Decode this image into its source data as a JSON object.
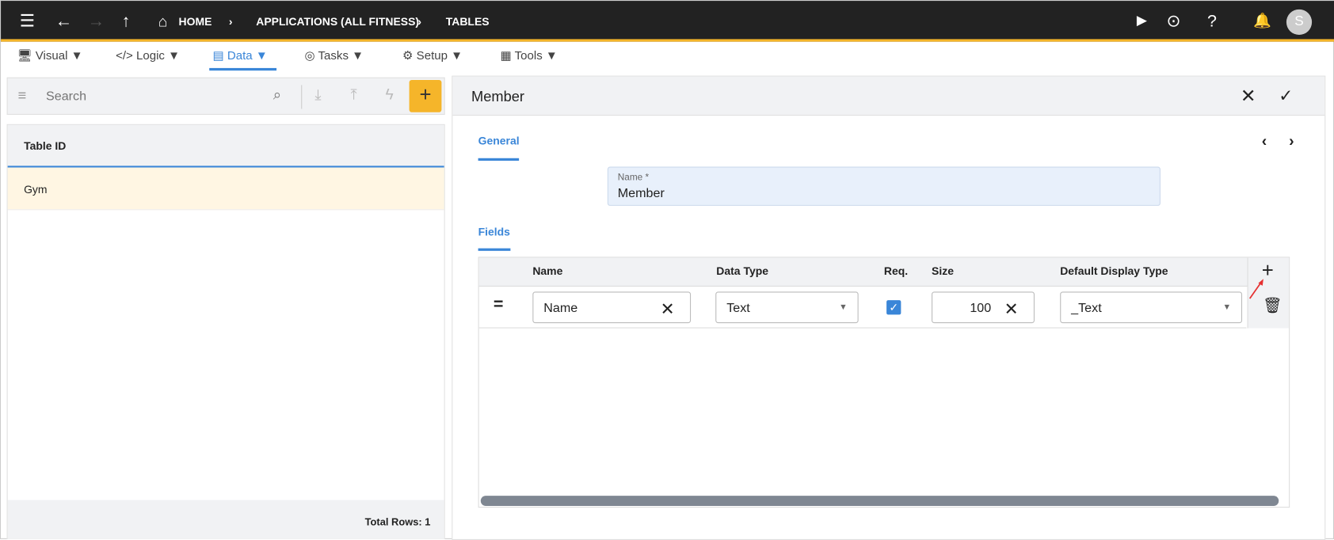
{
  "topbar": {
    "breadcrumb": [
      "HOME",
      "APPLICATIONS (ALL FITNESS)",
      "TABLES"
    ],
    "avatar": "S",
    "accent": "#f5b52a"
  },
  "menu": [
    {
      "label": "Visual ▼"
    },
    {
      "label": "Logic ▼"
    },
    {
      "label": "Data ▼",
      "active": true
    },
    {
      "label": "Tasks ▼"
    },
    {
      "label": "Setup ▼"
    },
    {
      "label": "Tools ▼"
    }
  ],
  "left": {
    "search_placeholder": "Search",
    "column": "Table ID",
    "rows": [
      "Gym"
    ],
    "footer": "Total Rows: 1"
  },
  "right": {
    "title": "Member",
    "tab_general": "General",
    "name_label": "Name *",
    "name_value": "Member",
    "tab_fields": "Fields",
    "columns": [
      "Name",
      "Data Type",
      "Req.",
      "Size",
      "Default Display Type"
    ],
    "row": {
      "name": "Name",
      "data_type": "Text",
      "required": true,
      "size": "100",
      "display_type": "_Text"
    }
  },
  "colors": {
    "active": "#3a86d8",
    "add_button": "#f5b52a",
    "selected_row": "#fff6e3"
  }
}
